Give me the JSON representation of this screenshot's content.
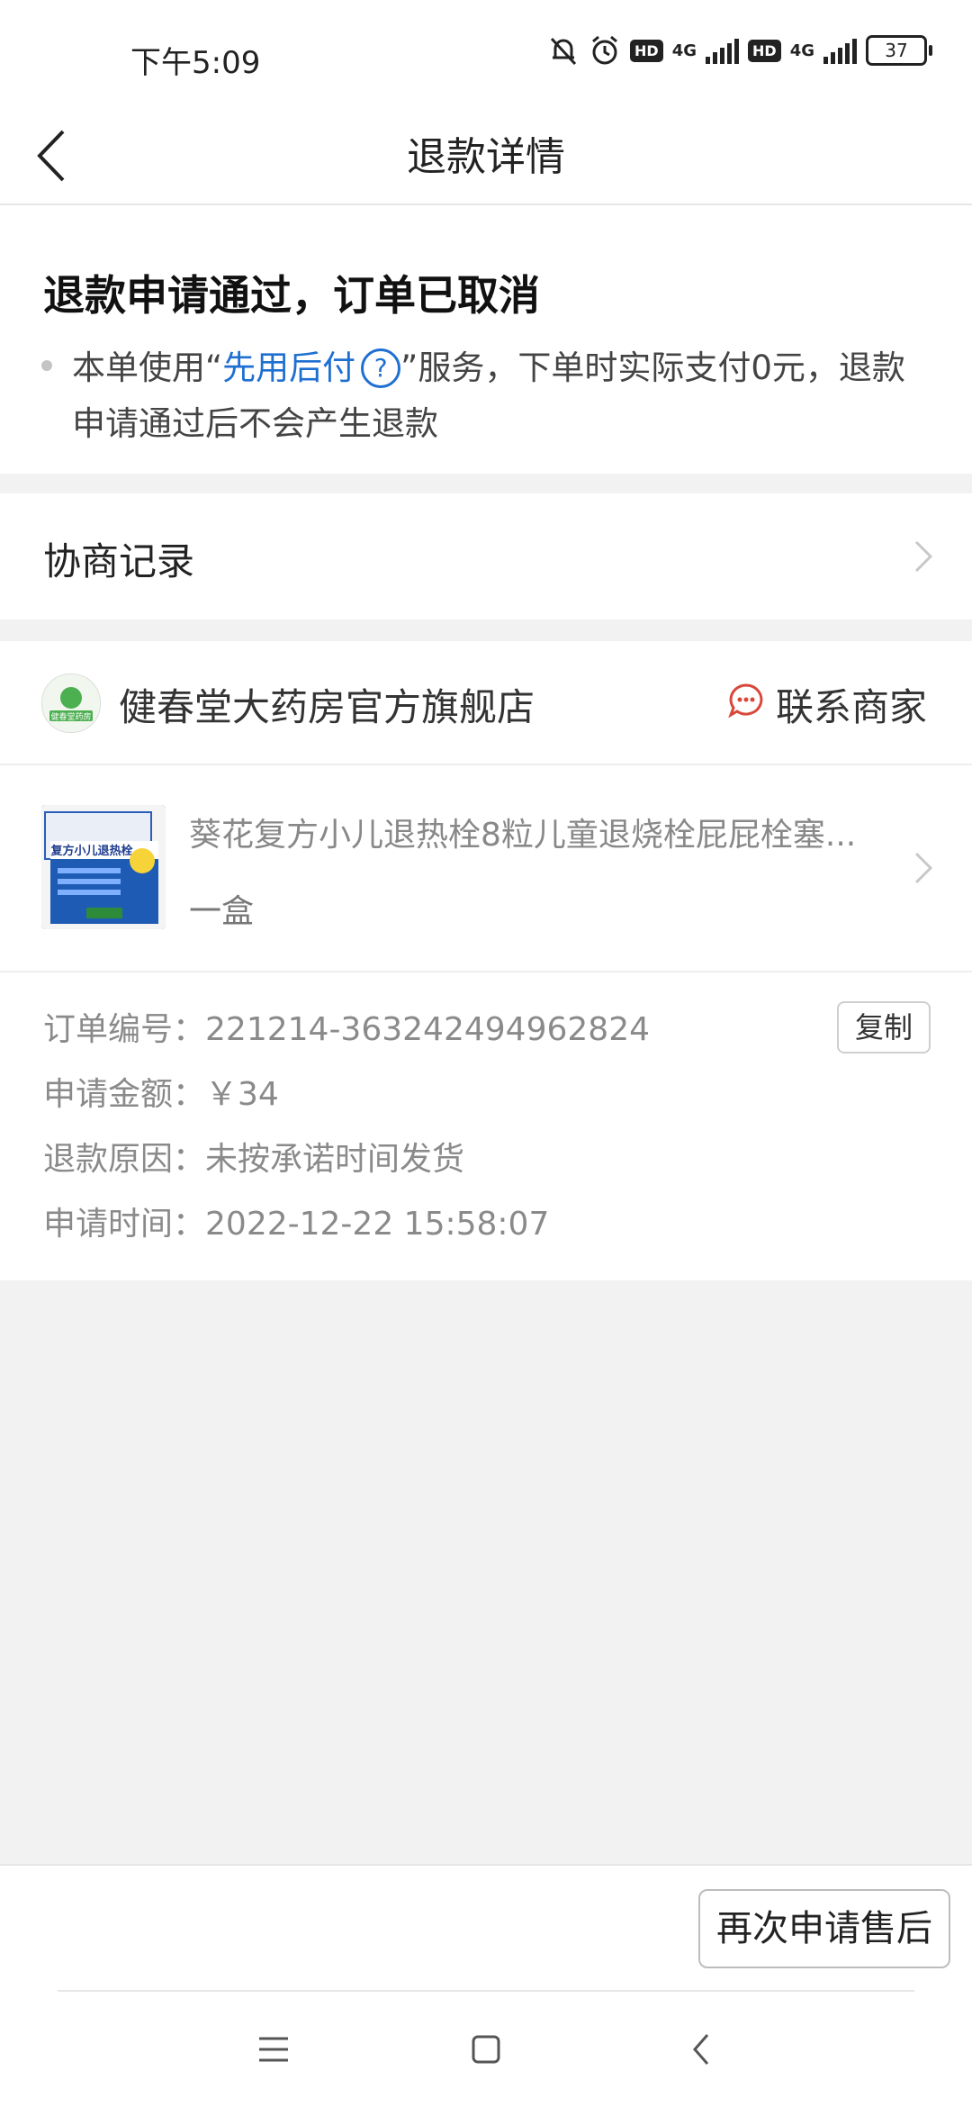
{
  "status_bar": {
    "time": "下午5:09",
    "hd1": "HD",
    "net1": "4G",
    "hd2": "HD",
    "net2": "4G",
    "battery": "37"
  },
  "nav": {
    "title": "退款详情"
  },
  "refund_status": {
    "title": "退款申请通过，订单已取消",
    "desc_prefix": "本单使用“",
    "service_link": "先用后付",
    "help_symbol": "?",
    "desc_suffix": "”服务，下单时实际支付0元，退款申请通过后不会产生退款"
  },
  "negotiation": {
    "label": "协商记录"
  },
  "shop": {
    "logo_text": "健春堂药房",
    "name": "健春堂大药房官方旗舰店",
    "contact_label": "联系商家"
  },
  "product": {
    "name": "葵花复方小儿退热栓8粒儿童退烧栓屁屁栓塞...",
    "spec": "一盒",
    "image_text": "复方小儿退热栓"
  },
  "order_info": {
    "order_no_label": "订单编号：",
    "order_no": "221214-363242494962824",
    "copy_label": "复制",
    "amount_label": "申请金额：",
    "amount": "￥34",
    "reason_label": "退款原因：",
    "reason": "未按承诺时间发货",
    "time_label": "申请时间：",
    "time": "2022-12-22 15:58:07"
  },
  "bottom": {
    "reapply_label": "再次申请售后"
  },
  "colors": {
    "link_blue": "#1f6fd1",
    "contact_red": "#d9473b",
    "page_bg": "#f2f2f2"
  }
}
